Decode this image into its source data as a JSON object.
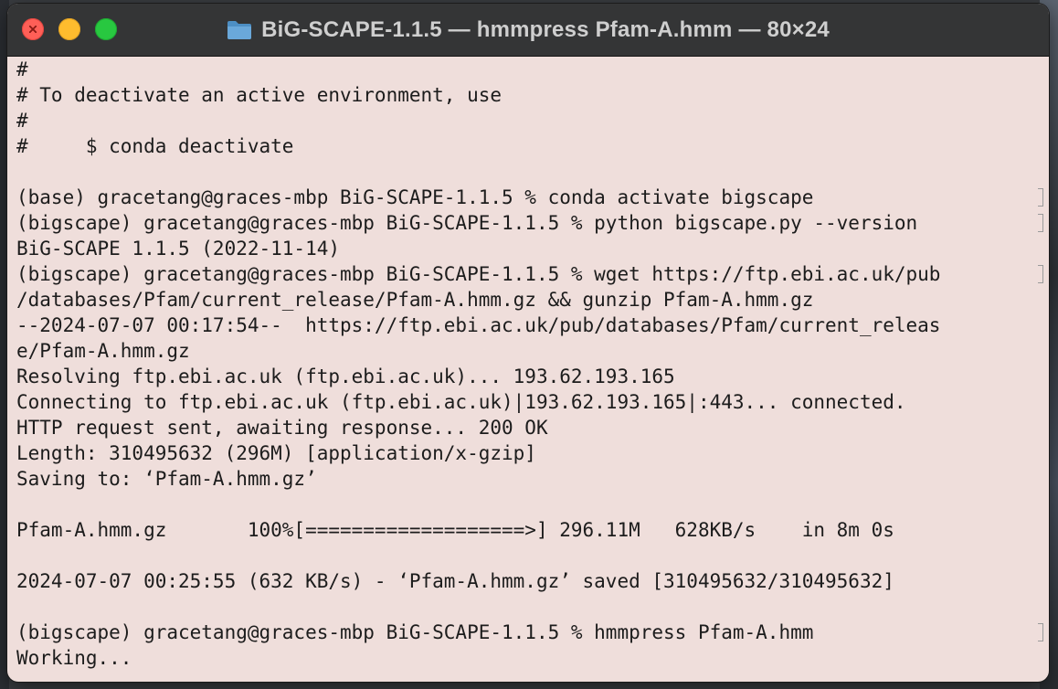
{
  "window": {
    "title": "BiG-SCAPE-1.1.5 — hmmpress Pfam-A.hmm — 80×24",
    "folder_icon": "folder-icon",
    "buttons": {
      "close": "close-button",
      "minimize": "minimize-button",
      "zoom": "zoom-button"
    }
  },
  "terminal": {
    "lines": [
      {
        "text": "#",
        "mark": false
      },
      {
        "text": "# To deactivate an active environment, use",
        "mark": false
      },
      {
        "text": "#",
        "mark": false
      },
      {
        "text": "#     $ conda deactivate",
        "mark": false
      },
      {
        "text": "",
        "mark": false
      },
      {
        "text": "(base) gracetang@graces-mbp BiG-SCAPE-1.1.5 % conda activate bigscape",
        "mark": true
      },
      {
        "text": "(bigscape) gracetang@graces-mbp BiG-SCAPE-1.1.5 % python bigscape.py --version",
        "mark": true
      },
      {
        "text": "BiG-SCAPE 1.1.5 (2022-11-14)",
        "mark": false
      },
      {
        "text": "(bigscape) gracetang@graces-mbp BiG-SCAPE-1.1.5 % wget https://ftp.ebi.ac.uk/pub",
        "mark": true
      },
      {
        "text": "/databases/Pfam/current_release/Pfam-A.hmm.gz && gunzip Pfam-A.hmm.gz",
        "mark": false
      },
      {
        "text": "--2024-07-07 00:17:54--  https://ftp.ebi.ac.uk/pub/databases/Pfam/current_releas",
        "mark": false
      },
      {
        "text": "e/Pfam-A.hmm.gz",
        "mark": false
      },
      {
        "text": "Resolving ftp.ebi.ac.uk (ftp.ebi.ac.uk)... 193.62.193.165",
        "mark": false
      },
      {
        "text": "Connecting to ftp.ebi.ac.uk (ftp.ebi.ac.uk)|193.62.193.165|:443... connected.",
        "mark": false
      },
      {
        "text": "HTTP request sent, awaiting response... 200 OK",
        "mark": false
      },
      {
        "text": "Length: 310495632 (296M) [application/x-gzip]",
        "mark": false
      },
      {
        "text": "Saving to: ‘Pfam-A.hmm.gz’",
        "mark": false
      },
      {
        "text": "",
        "mark": false
      },
      {
        "text": "Pfam-A.hmm.gz       100%[===================>] 296.11M   628KB/s    in 8m 0s",
        "mark": false
      },
      {
        "text": "",
        "mark": false
      },
      {
        "text": "2024-07-07 00:25:55 (632 KB/s) - ‘Pfam-A.hmm.gz’ saved [310495632/310495632]",
        "mark": false
      },
      {
        "text": "",
        "mark": false
      },
      {
        "text": "(bigscape) gracetang@graces-mbp BiG-SCAPE-1.1.5 % hmmpress Pfam-A.hmm",
        "mark": true
      },
      {
        "text": "Working...",
        "mark": false
      }
    ]
  }
}
